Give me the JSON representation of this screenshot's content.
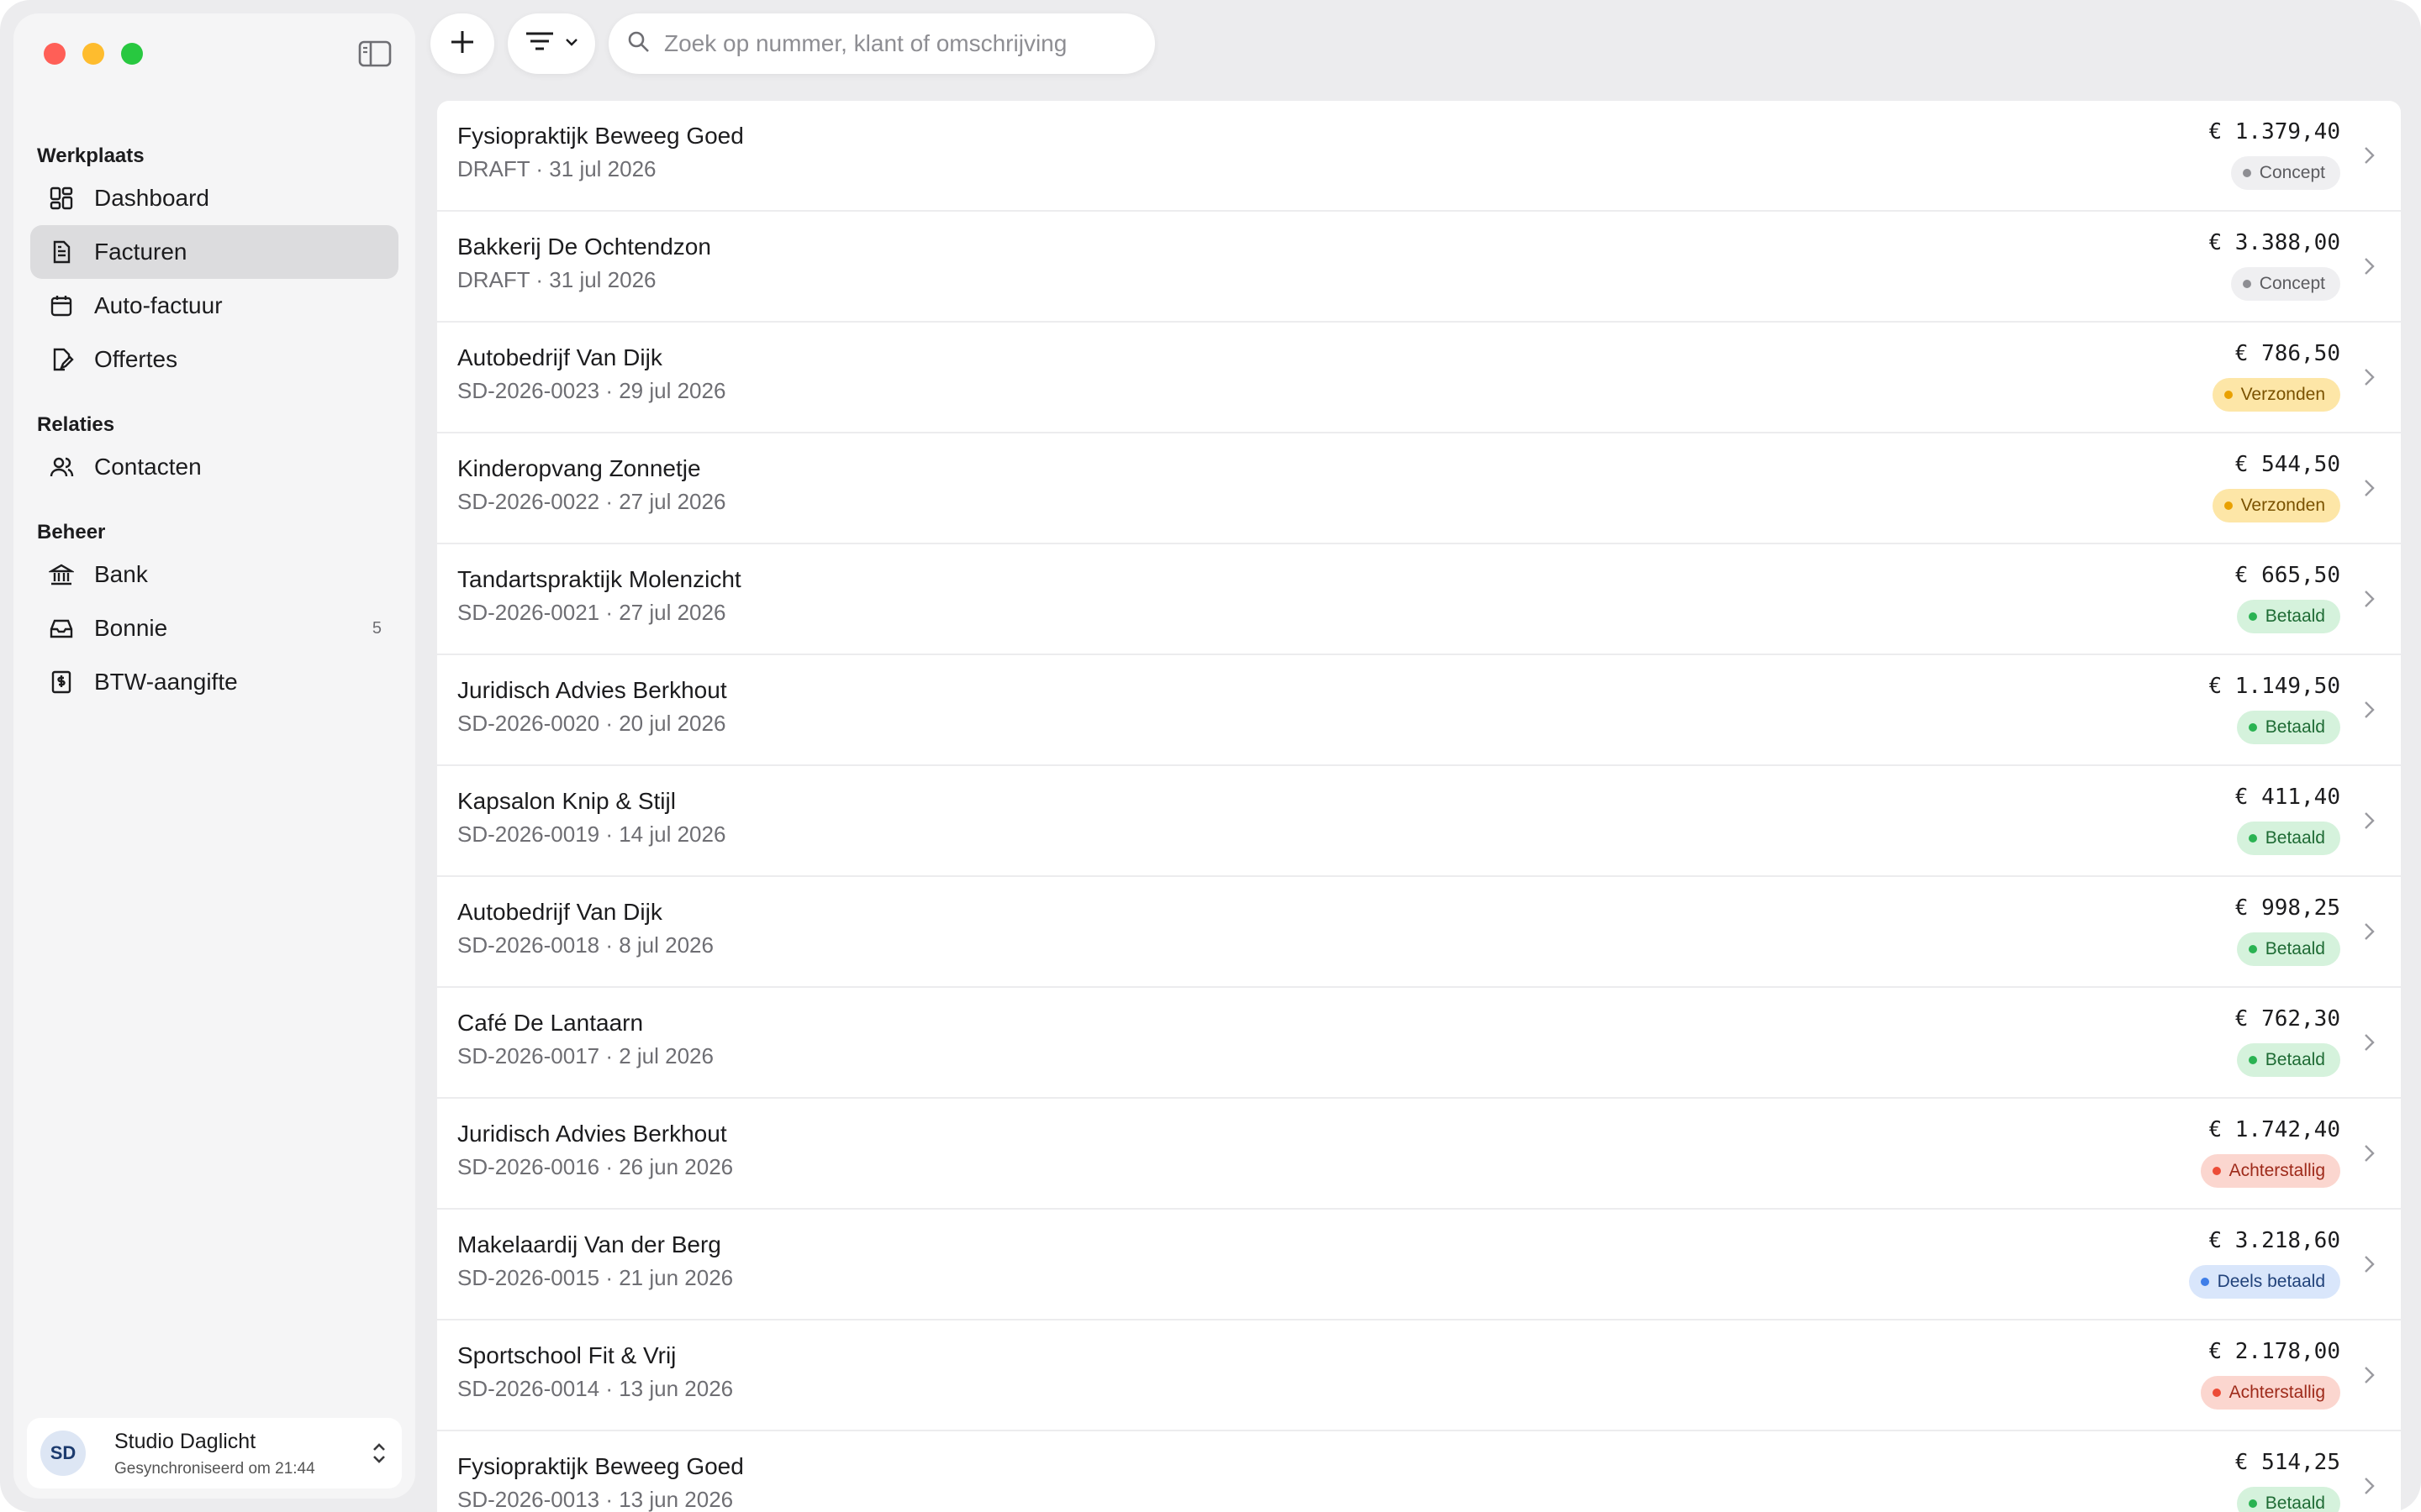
{
  "sidebar": {
    "sections": [
      {
        "title": "Werkplaats"
      },
      {
        "title": "Relaties"
      },
      {
        "title": "Beheer"
      }
    ],
    "items": [
      {
        "label": "Dashboard",
        "icon": "dashboard-grid-icon"
      },
      {
        "label": "Facturen",
        "icon": "invoice-document-icon",
        "active": true
      },
      {
        "label": "Auto-factuur",
        "icon": "calendar-icon"
      },
      {
        "label": "Offertes",
        "icon": "document-edit-icon"
      },
      {
        "label": "Contacten",
        "icon": "people-icon"
      },
      {
        "label": "Bank",
        "icon": "bank-icon"
      },
      {
        "label": "Bonnie",
        "icon": "inbox-tray-icon",
        "badge": "5"
      },
      {
        "label": "BTW-aangifte",
        "icon": "tax-receipt-icon"
      }
    ],
    "profile": {
      "initials": "SD",
      "name": "Studio Daglicht",
      "sync": "Gesynchroniseerd om 21:44"
    }
  },
  "toolbar": {
    "search_placeholder": "Zoek op nummer, klant of omschrijving"
  },
  "colors": {
    "concept": "#efeff1",
    "verzonden": "#fde6a7",
    "betaald": "#d5f2dc",
    "achterstallig": "#fbd6cf",
    "deels_betaald": "#d9e6fb"
  },
  "invoices": [
    {
      "client": "Fysiopraktijk Beweeg Goed",
      "meta": "DRAFT · 31 jul 2026",
      "amount": "€ 1.379,40",
      "status": "Concept",
      "status_class": "concept"
    },
    {
      "client": "Bakkerij De Ochtendzon",
      "meta": "DRAFT · 31 jul 2026",
      "amount": "€ 3.388,00",
      "status": "Concept",
      "status_class": "concept"
    },
    {
      "client": "Autobedrijf Van Dijk",
      "meta": "SD-2026-0023 · 29 jul 2026",
      "amount": "€ 786,50",
      "status": "Verzonden",
      "status_class": "sent"
    },
    {
      "client": "Kinderopvang Zonnetje",
      "meta": "SD-2026-0022 · 27 jul 2026",
      "amount": "€ 544,50",
      "status": "Verzonden",
      "status_class": "sent"
    },
    {
      "client": "Tandartspraktijk Molenzicht",
      "meta": "SD-2026-0021 · 27 jul 2026",
      "amount": "€ 665,50",
      "status": "Betaald",
      "status_class": "paid"
    },
    {
      "client": "Juridisch Advies Berkhout",
      "meta": "SD-2026-0020 · 20 jul 2026",
      "amount": "€ 1.149,50",
      "status": "Betaald",
      "status_class": "paid"
    },
    {
      "client": "Kapsalon Knip & Stijl",
      "meta": "SD-2026-0019 · 14 jul 2026",
      "amount": "€ 411,40",
      "status": "Betaald",
      "status_class": "paid"
    },
    {
      "client": "Autobedrijf Van Dijk",
      "meta": "SD-2026-0018 · 8 jul 2026",
      "amount": "€ 998,25",
      "status": "Betaald",
      "status_class": "paid"
    },
    {
      "client": "Café De Lantaarn",
      "meta": "SD-2026-0017 · 2 jul 2026",
      "amount": "€ 762,30",
      "status": "Betaald",
      "status_class": "paid"
    },
    {
      "client": "Juridisch Advies Berkhout",
      "meta": "SD-2026-0016 · 26 jun 2026",
      "amount": "€ 1.742,40",
      "status": "Achterstallig",
      "status_class": "late"
    },
    {
      "client": "Makelaardij Van der Berg",
      "meta": "SD-2026-0015 · 21 jun 2026",
      "amount": "€ 3.218,60",
      "status": "Deels betaald",
      "status_class": "partial"
    },
    {
      "client": "Sportschool Fit & Vrij",
      "meta": "SD-2026-0014 · 13 jun 2026",
      "amount": "€ 2.178,00",
      "status": "Achterstallig",
      "status_class": "late"
    },
    {
      "client": "Fysiopraktijk Beweeg Goed",
      "meta": "SD-2026-0013 · 13 jun 2026",
      "amount": "€ 514,25",
      "status": "Betaald",
      "status_class": "paid"
    }
  ]
}
